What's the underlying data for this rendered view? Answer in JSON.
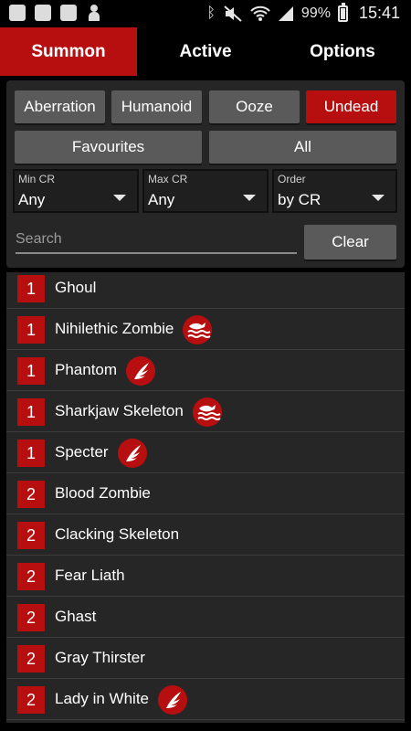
{
  "status_bar": {
    "battery": "99%",
    "battery_level": 0.99,
    "time": "15:41",
    "left_icons": [
      "sync-icon",
      "gallery-icon",
      "shield-icon",
      "person-icon"
    ],
    "right_icons": [
      "bluetooth-icon",
      "mute-icon",
      "wifi-icon",
      "signal-icon",
      "battery-icon"
    ]
  },
  "tabs": [
    {
      "label": "Summon",
      "active": true
    },
    {
      "label": "Active",
      "active": false
    },
    {
      "label": "Options",
      "active": false
    }
  ],
  "filters": {
    "types": [
      {
        "label": "Aberration",
        "selected": false
      },
      {
        "label": "Humanoid",
        "selected": false
      },
      {
        "label": "Ooze",
        "selected": false
      },
      {
        "label": "Undead",
        "selected": true
      }
    ],
    "favourites_label": "Favourites",
    "all_label": "All",
    "min_cr": {
      "caption": "Min CR",
      "value": "Any"
    },
    "max_cr": {
      "caption": "Max CR",
      "value": "Any"
    },
    "order": {
      "caption": "Order",
      "value": "by CR"
    },
    "search_placeholder": "Search",
    "clear_label": "Clear"
  },
  "accent_color": "#b70f0f",
  "monsters": [
    {
      "cr": "1",
      "name": "Ghoul",
      "badge": null
    },
    {
      "cr": "1",
      "name": "Nihilethic Zombie",
      "badge": "swim-icon"
    },
    {
      "cr": "1",
      "name": "Phantom",
      "badge": "wing-icon"
    },
    {
      "cr": "1",
      "name": "Sharkjaw Skeleton",
      "badge": "swim-icon"
    },
    {
      "cr": "1",
      "name": "Specter",
      "badge": "wing-icon"
    },
    {
      "cr": "2",
      "name": "Blood Zombie",
      "badge": null
    },
    {
      "cr": "2",
      "name": "Clacking Skeleton",
      "badge": null
    },
    {
      "cr": "2",
      "name": "Fear Liath",
      "badge": null
    },
    {
      "cr": "2",
      "name": "Ghast",
      "badge": null
    },
    {
      "cr": "2",
      "name": "Gray Thirster",
      "badge": null
    },
    {
      "cr": "2",
      "name": "Lady in White",
      "badge": "wing-icon"
    }
  ]
}
